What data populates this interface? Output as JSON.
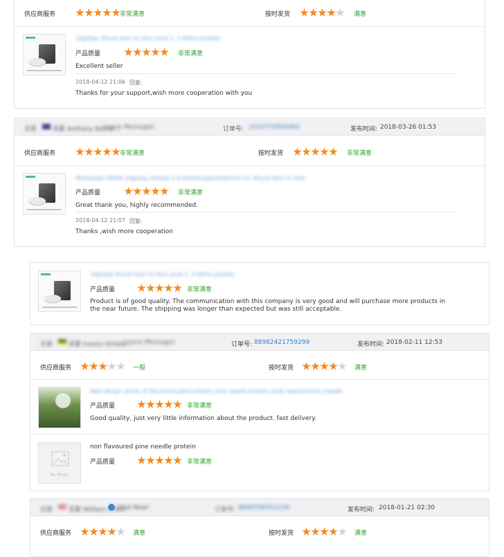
{
  "labels": {
    "supplier_service": "供应商服务",
    "on_time_delivery": "按时发货",
    "product_quality": "产品质量",
    "order_no": "订单号:",
    "publish_time": "发布时间:",
    "reply": "回复:",
    "leave_messages": "Leave Messages",
    "no_photo": "No Photo"
  },
  "ratings": {
    "very_satisfied": "非常满意",
    "satisfied": "满意",
    "average": "一般"
  },
  "review1": {
    "supplier_stars": 5,
    "supplier_text": "非常满意",
    "delivery_stars": 4,
    "delivery_text": "满意",
    "product_title": "10g/bag 3Gusd door to door pure 1, 3 dithia powder",
    "quality_stars": 5,
    "quality_text": "非常满意",
    "comment": "Excellent seller",
    "reply_date": "2018-04-12 21:06",
    "reply_label": "回复:",
    "reply_text": "Thanks for your support,wish more cooperation with you"
  },
  "review2": {
    "reviewer": "买家 Anthony Belcal...",
    "order_no": "1022774956462",
    "publish_time": "2018-03-26 01:53",
    "supplier_stars": 5,
    "supplier_text": "非常满意",
    "delivery_stars": 5,
    "delivery_text": "非常满意",
    "product_title": "Wholesale DMHA 10g/bag sample 1,3-dimethylpentylamine hcl 3Gusd door to door",
    "quality_stars": 5,
    "quality_text": "非常满意",
    "comment": "Great thank you, highly recommended.",
    "reply_date": "2018-04-12 21:07",
    "reply_label": "回复:",
    "reply_text": "Thanks ,wish more cooperation"
  },
  "review3": {
    "product_title": "10g/bag 3Gusd door to door pure 1, 3 dithia powder",
    "quality_stars": 5,
    "quality_text": "非常满意",
    "comment": "Product is of good quality. The communication with this company is very good and will purchase more products in the near future. The shipping was longer than expected but was still acceptable."
  },
  "review4": {
    "reviewer": "买家 Ivanov Kritelo...",
    "order_no": "88982421759299",
    "publish_time": "2018-02-11 12:53",
    "supplier_stars": 3,
    "supplier_text": "一般",
    "delivery_stars": 4,
    "delivery_text": "满意",
    "product_title": "New design words of flavoured plant protein pine needle protein meal replacement powder",
    "quality_stars": 5,
    "quality_text": "非常满意",
    "comment": "Good quality, just very little information about the product. fast delivery.",
    "product2_title": "non flavoured pine needle protein",
    "quality2_stars": 5,
    "quality2_text": "非常满意"
  },
  "review5": {
    "reviewer": "买家 William smith",
    "reviewer_tag": "Chat Now!",
    "order_no": "8849356551236",
    "publish_time": "2018-01-21 02:30",
    "supplier_stars": 4,
    "supplier_text": "满意",
    "delivery_stars": 4,
    "delivery_text": "满意"
  },
  "colors": {
    "star_on": "#f5891f",
    "star_off": "#d2d2d2",
    "rating_green": "#31a32c",
    "link_blue": "#3b7fc4"
  }
}
